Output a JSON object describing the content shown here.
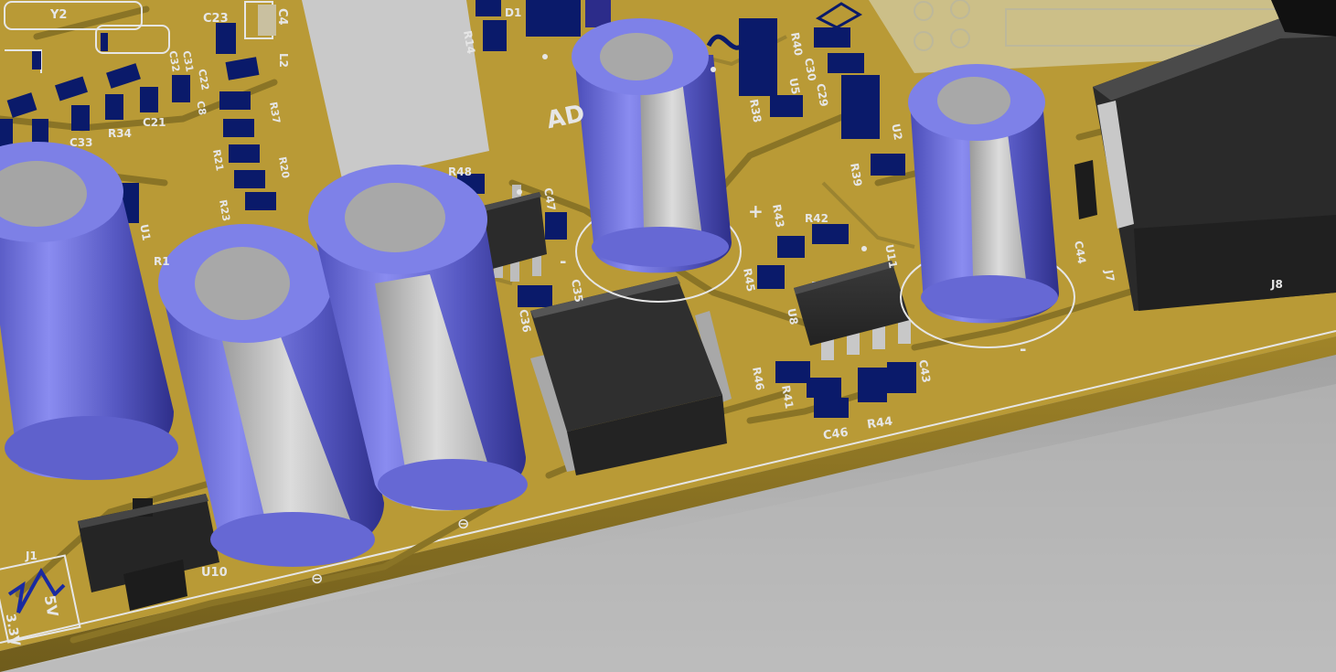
{
  "viewport": {
    "kind": "3d-pcb-view"
  },
  "colors": {
    "board": "#b99a36",
    "board_dark": "#8a7426",
    "board_edge": "#a08428",
    "silk": "#e6e6e6",
    "pad": "#0a1a6a",
    "capacitor": "#6f71d8",
    "capacitor_sleeve": "#c9c9c9",
    "ic_body": "#2e2e2e",
    "background": "#9a9a9a"
  },
  "labels": {
    "y2": "Y2",
    "c23": "C23",
    "c4": "C4",
    "l2": "L2",
    "r14": "R14",
    "d1": "D1",
    "r40": "R40",
    "c30": "C30",
    "c29": "C29",
    "u5": "U5",
    "r38": "R38",
    "r39": "R39",
    "u2": "U2",
    "c32": "C32",
    "c31": "C31",
    "c22": "C22",
    "c8": "C8",
    "r37": "R37",
    "r21": "R21",
    "r20": "R20",
    "r23": "R23",
    "c33": "C33",
    "r34": "R34",
    "c21": "C21",
    "u1": "U1",
    "r1": "R1",
    "r48": "R48",
    "c47": "C47",
    "c35": "C35",
    "c36": "C36",
    "ad": "AD",
    "r43": "R43",
    "r42": "R42",
    "r45": "R45",
    "u11": "U11",
    "u8": "U8",
    "r46": "R46",
    "r41": "R41",
    "c46": "C46",
    "r44": "R44",
    "c43": "C43",
    "c44": "C44",
    "j7": "J7",
    "j8": "J8",
    "u10": "U10",
    "j1": "J1",
    "v5": "5V",
    "v33": "3.3V",
    "plus": "+",
    "minus": "-",
    "minus2": "-",
    "polarity1": "⊖",
    "polarity2": "⊖"
  }
}
